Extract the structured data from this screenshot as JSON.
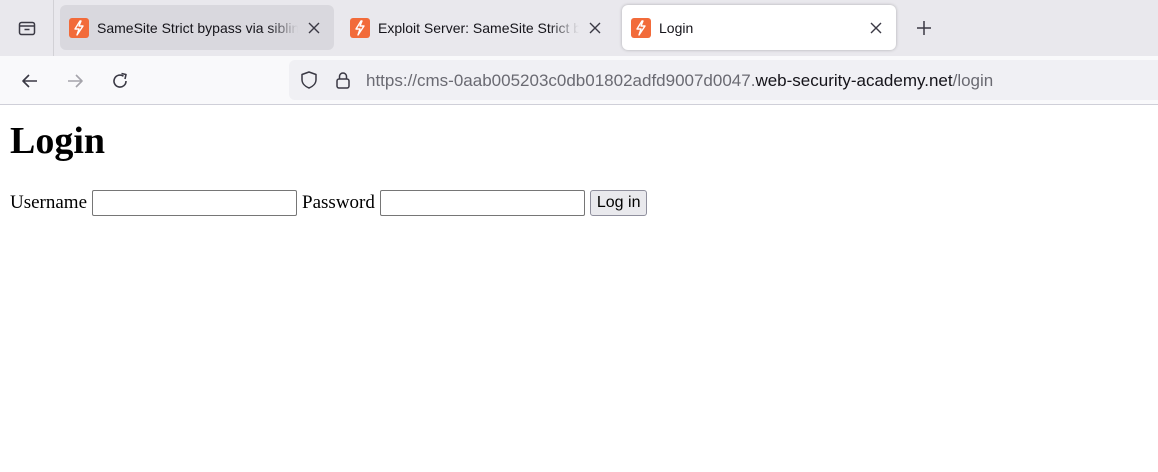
{
  "browser": {
    "tabs": [
      {
        "title": "SameSite Strict bypass via sibling domain",
        "state": "inactive"
      },
      {
        "title": "Exploit Server: SameSite Strict bypass via sibling domain",
        "state": "inactive"
      },
      {
        "title": "Login",
        "state": "active"
      }
    ],
    "url": {
      "prefix": "https://cms-0aab005203c0db01802adfd9007d0047.",
      "host": "web-security-academy.net",
      "path": "/login"
    },
    "icons": {
      "tab_manager": "tab-manager-icon",
      "favicon": "lightning-bolt-favicon",
      "close": "close-icon",
      "new_tab": "plus-icon",
      "back": "back-arrow-icon",
      "forward": "forward-arrow-icon",
      "reload": "reload-icon",
      "tracking_protection": "shield-icon",
      "secure": "lock-icon"
    },
    "colors": {
      "favicon": "#f26b3a",
      "tabstrip": "#e9e8ed",
      "urlbar": "#f0f0f4"
    }
  },
  "page": {
    "heading": "Login",
    "form": {
      "username_label": "Username",
      "username_value": "",
      "password_label": "Password",
      "password_value": "",
      "submit_label": "Log in"
    }
  }
}
